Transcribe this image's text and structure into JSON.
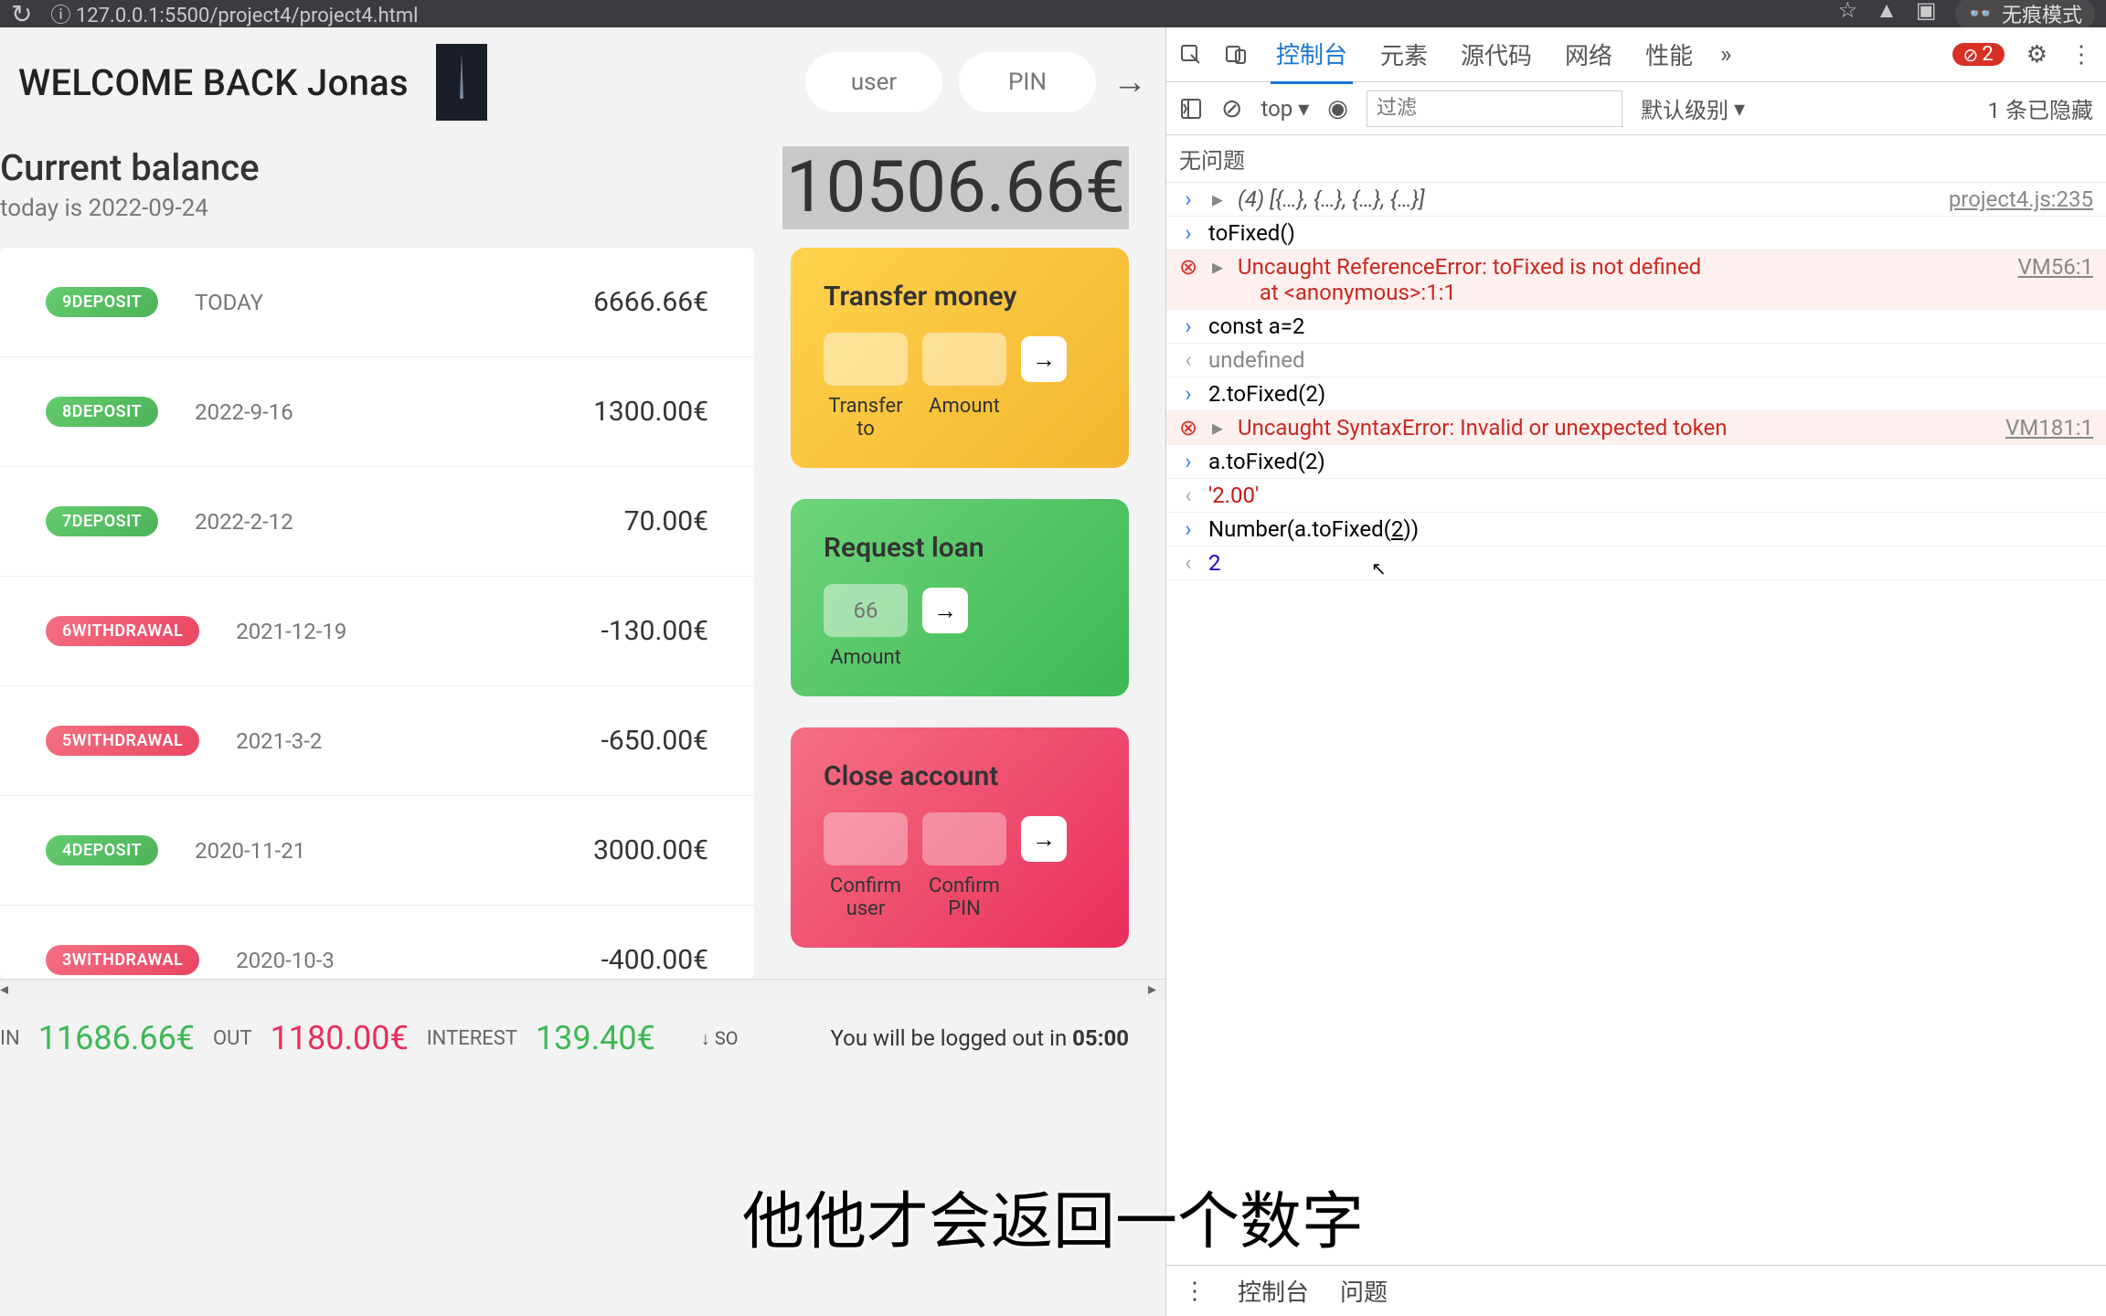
{
  "browser": {
    "url_prefix": "127.0.0.1",
    "url_suffix": ":5500/project4/project4.html",
    "incognito_label": "无痕模式"
  },
  "app": {
    "welcome": "WELCOME BACK Jonas",
    "login_user_placeholder": "user",
    "login_pin_placeholder": "PIN",
    "balance_title": "Current balance",
    "balance_date": "today is 2022-09-24",
    "balance_value": "10506.66€",
    "movements": [
      {
        "tag": "9DEPOSIT",
        "type": "deposit",
        "date": "TODAY",
        "amount": "6666.66€"
      },
      {
        "tag": "8DEPOSIT",
        "type": "deposit",
        "date": "2022-9-16",
        "amount": "1300.00€"
      },
      {
        "tag": "7DEPOSIT",
        "type": "deposit",
        "date": "2022-2-12",
        "amount": "70.00€"
      },
      {
        "tag": "6WITHDRAWAL",
        "type": "withdrawal",
        "date": "2021-12-19",
        "amount": "-130.00€"
      },
      {
        "tag": "5WITHDRAWAL",
        "type": "withdrawal",
        "date": "2021-3-2",
        "amount": "-650.00€"
      },
      {
        "tag": "4DEPOSIT",
        "type": "deposit",
        "date": "2020-11-21",
        "amount": "3000.00€"
      },
      {
        "tag": "3WITHDRAWAL",
        "type": "withdrawal",
        "date": "2020-10-3",
        "amount": "-400.00€"
      }
    ],
    "transfer": {
      "title": "Transfer money",
      "to_label": "Transfer to",
      "amount_label": "Amount"
    },
    "loan": {
      "title": "Request loan",
      "amount_label": "Amount",
      "placeholder": "66"
    },
    "close": {
      "title": "Close account",
      "user_label": "Confirm user",
      "pin_label": "Confirm PIN"
    },
    "summary": {
      "in_label": "IN",
      "in_value": "11686.66€",
      "out_label": "OUT",
      "out_value": "1180.00€",
      "interest_label": "INTEREST",
      "interest_value": "139.40€",
      "sort_hint": "SO",
      "timer_prefix": "You will be logged out in ",
      "timer_value": "05:00"
    }
  },
  "devtools": {
    "tabs": {
      "console": "控制台",
      "elements": "元素",
      "sources": "源代码",
      "network": "网络",
      "performance": "性能"
    },
    "error_count": "2",
    "context": "top",
    "filter_placeholder": "过滤",
    "level": "默认级别",
    "hidden": "1 条已隐藏",
    "no_issues": "无问题",
    "lines": [
      {
        "kind": "in",
        "text": "(4) [{…}, {…}, {…}, {…}]",
        "cls": "italic",
        "src": "project4.js:235"
      },
      {
        "kind": "in",
        "text": "toFixed()"
      },
      {
        "kind": "err",
        "text": "Uncaught ReferenceError: toFixed is not defined\n    at <anonymous>:1:1",
        "src": "VM56:1"
      },
      {
        "kind": "in",
        "text": "const a=2"
      },
      {
        "kind": "out",
        "text": "undefined",
        "cls": "undef"
      },
      {
        "kind": "in",
        "text": "2.toFixed(2)"
      },
      {
        "kind": "err",
        "text": "Uncaught SyntaxError: Invalid or unexpected token",
        "src": "VM181:1"
      },
      {
        "kind": "in",
        "text": "a.toFixed(2)"
      },
      {
        "kind": "out",
        "text": "'2.00'",
        "cls": "str"
      },
      {
        "kind": "inlive",
        "text": "Number(a.toFixed(2))"
      },
      {
        "kind": "out",
        "text": "2",
        "cls": "num"
      }
    ],
    "drawer": {
      "console": "控制台",
      "issues": "问题"
    }
  },
  "caption": "他他才会返回一个数字"
}
